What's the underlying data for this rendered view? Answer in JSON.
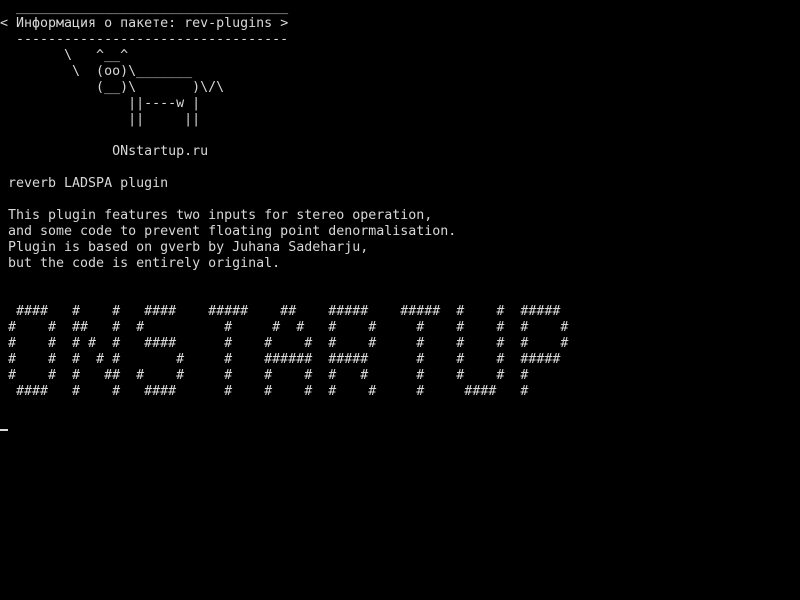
{
  "terminal": {
    "banner": {
      "top_rule": " __________________________________",
      "title": "< Информация о пакете: rev-plugins >",
      "bottom_rule": " ----------------------------------"
    },
    "cow": [
      "       \\   ^__^",
      "        \\  (oo)\\_______",
      "           (__)\\       )\\/\\",
      "               ||----w |",
      "               ||     ||"
    ],
    "site": "             ONstartup.ru",
    "package_summary": "reverb LADSPA plugin",
    "description": [
      "This plugin features two inputs for stereo operation,",
      "and some code to prevent floating point denormalisation.",
      "Plugin is based on gverb by Juhana Sadeharju,",
      "but the code is entirely original."
    ],
    "ascii_art": [
      " ####   #    #   ####    #####    ##    #####    #####  #    #  #####",
      "#    #  ##   #  #          #     #  #   #    #     #    #    #  #    #",
      "#    #  # #  #   ####      #    #    #  #    #     #    #    #  #    #",
      "#    #  #  # #       #     #    ######  #####      #    #    #  #####",
      "#    #  #   ##  #    #     #    #    #  #   #      #    #    #  #",
      " ####   #    #   ####      #    #    #  #    #     #     ####   #"
    ],
    "colors": {
      "background": "#000000",
      "foreground": "#d8d8d8"
    }
  }
}
